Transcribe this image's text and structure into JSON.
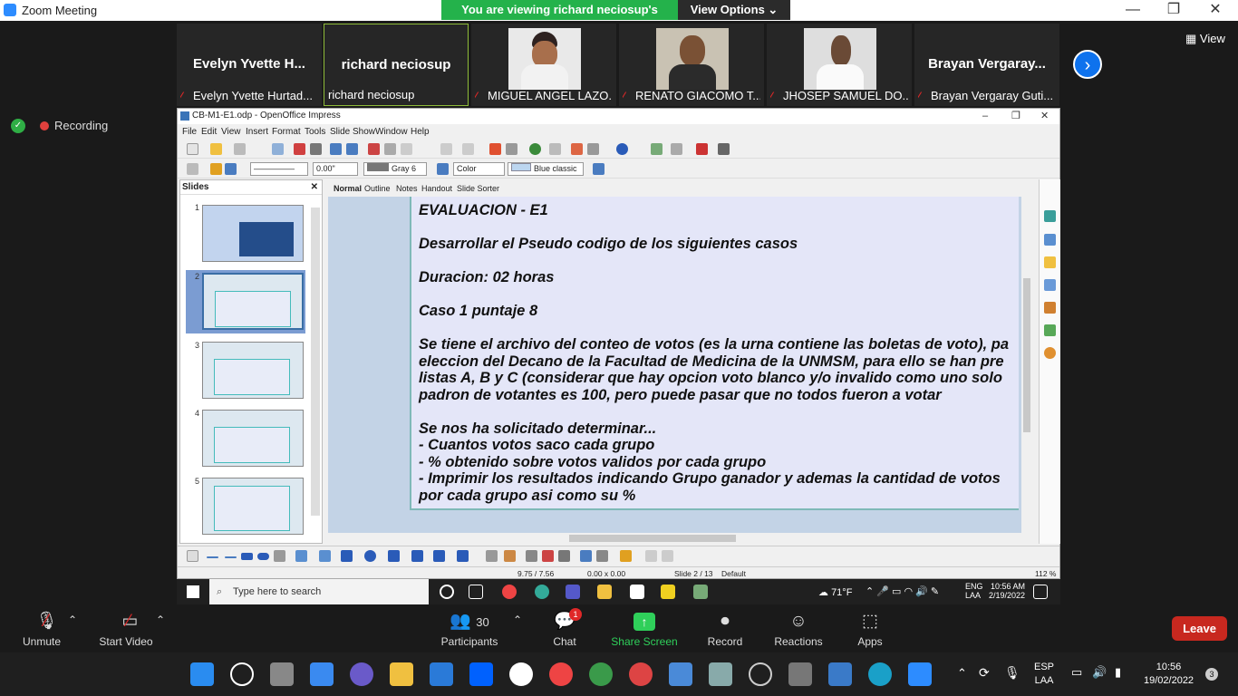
{
  "window": {
    "title": "Zoom Meeting",
    "minimize": "—",
    "maximize": "❐",
    "close": "✕"
  },
  "share_banner": {
    "message": "You are viewing richard neciosup's screen",
    "view_options": "View Options ⌄"
  },
  "gallery": {
    "tiles": [
      {
        "big_name": "Evelyn  Yvette  H...",
        "caption": "Evelyn Yvette Hurtad...",
        "muted": true
      },
      {
        "big_name": "richard neciosup",
        "caption": "richard neciosup",
        "muted": false
      },
      {
        "big_name": "",
        "caption": "MIGUEL ANGEL LAZO...",
        "muted": true
      },
      {
        "big_name": "",
        "caption": "RENATO GIACOMO T...",
        "muted": true
      },
      {
        "big_name": "",
        "caption": "JHOSEP SAMUEL DO...",
        "muted": true
      },
      {
        "big_name": "Brayan  Vergaray...",
        "caption": "Brayan Vergaray Guti...",
        "muted": true
      }
    ],
    "next_arrow": "›",
    "view_label": "View"
  },
  "recording": {
    "label": "Recording"
  },
  "impress": {
    "title": "CB-M1-E1.odp - OpenOffice Impress",
    "menu": [
      "File",
      "Edit",
      "View",
      "Insert",
      "Format",
      "Tools",
      "Slide Show",
      "Window",
      "Help"
    ],
    "line_width": "0.00\"",
    "fill_color": "Gray 6",
    "fill_type": "Color",
    "area_style": "Blue classic",
    "slides_panel_title": "Slides",
    "slide_numbers": [
      "1",
      "2",
      "3",
      "4",
      "5"
    ],
    "view_tabs": [
      "Normal",
      "Outline",
      "Notes",
      "Handout",
      "Slide Sorter"
    ],
    "slide_text": {
      "l1": "EVALUACION - E1",
      "l2": "Desarrollar el Pseudo codigo de los siguientes casos",
      "l3": "Duracion: 02 horas",
      "l4": "Caso 1    puntaje 8",
      "l5": "Se tiene el archivo del conteo de votos (es la urna contiene las boletas de voto), pa",
      "l6": "eleccion del Decano de la Facultad de Medicina de la UNMSM, para ello se han pre",
      "l7": "listas A, B y C  (considerar que hay opcion voto blanco y/o invalido como uno solo",
      "l8": "padron de votantes es 100, pero puede pasar que no todos fueron a votar",
      "l9": "Se nos ha solicitado determinar...",
      "l10": " - Cuantos votos saco cada grupo",
      "l11": " - % obtenido sobre votos validos por cada grupo",
      "l12": " - Imprimir los resultados indicando Grupo ganador y ademas la cantidad de votos",
      "l13": "por cada grupo asi como su %"
    },
    "status": {
      "position": "9.75 / 7.56",
      "size": "0.00 x 0.00",
      "slide": "Slide 2 / 13",
      "layout": "Default",
      "zoom": "112 %"
    }
  },
  "remote_taskbar": {
    "search_placeholder": "Type here to search",
    "temp": "71°F",
    "lang1": "ENG",
    "lang2": "LAA",
    "time": "10:56 AM",
    "date": "2/19/2022"
  },
  "zoom_controls": {
    "unmute": "Unmute",
    "start_video": "Start Video",
    "participants": "Participants",
    "participants_count": "30",
    "chat": "Chat",
    "chat_badge": "1",
    "share_screen": "Share Screen",
    "record": "Record",
    "reactions": "Reactions",
    "apps": "Apps",
    "leave": "Leave"
  },
  "local_taskbar": {
    "lang1": "ESP",
    "lang2": "LAA",
    "time": "10:56",
    "date": "19/02/2022",
    "notif": "3"
  }
}
